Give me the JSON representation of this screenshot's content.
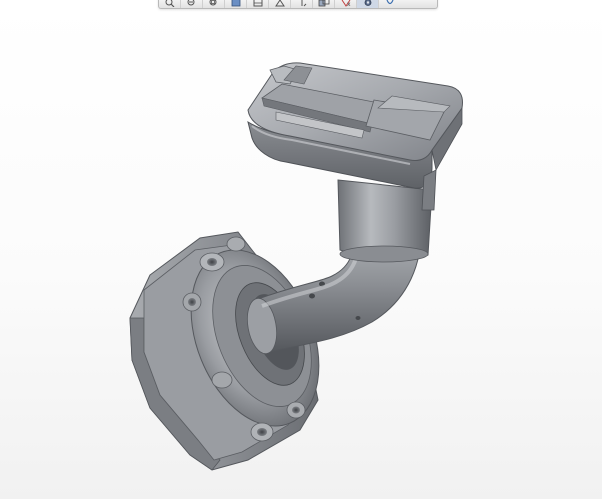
{
  "window": {
    "background_top": "#ffffff",
    "background_bottom": "#f1f1f1"
  },
  "toolbar": {
    "buttons": [
      {
        "name": "zoom-in-icon"
      },
      {
        "name": "zoom-out-icon"
      },
      {
        "name": "refit-icon"
      },
      {
        "name": "repaint-icon"
      },
      {
        "name": "view-normal-icon"
      },
      {
        "name": "saved-views-icon"
      },
      {
        "name": "display-style-icon"
      },
      {
        "name": "perspective-icon"
      },
      {
        "name": "spin-center-icon"
      },
      {
        "name": "annotation-display-icon"
      },
      {
        "name": "datum-display-icon"
      },
      {
        "name": "settings-icon"
      }
    ]
  },
  "model": {
    "part_color": "#8d9095",
    "highlight_color": "#c9cbce",
    "shadow_color": "#4f5257"
  }
}
